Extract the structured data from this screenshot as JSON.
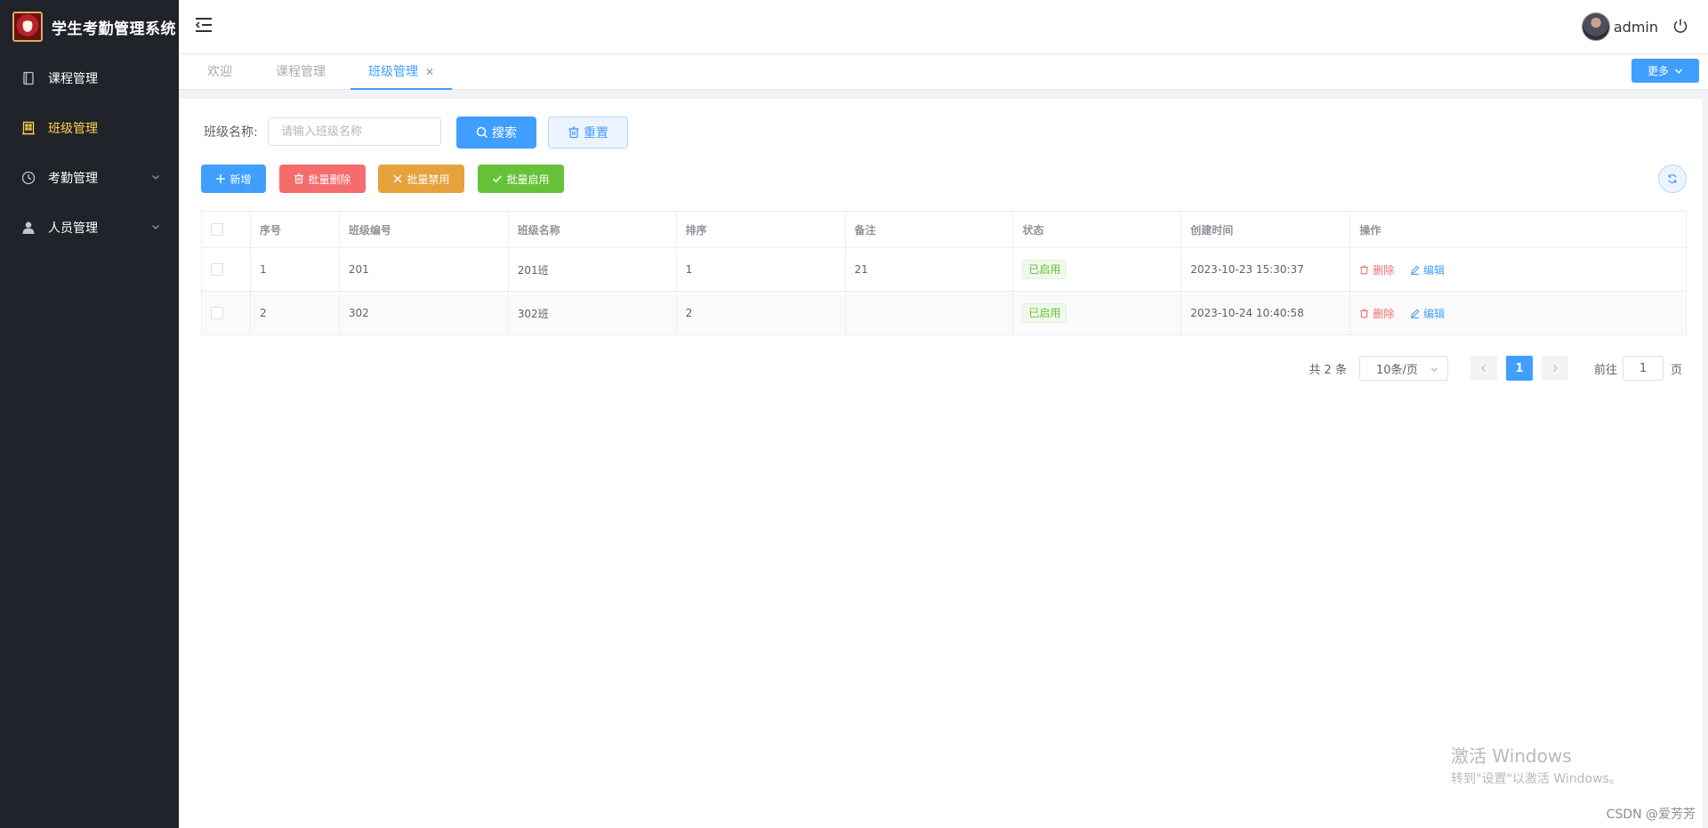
{
  "app": {
    "title": "学生考勤管理系统"
  },
  "sidebar": {
    "items": [
      {
        "label": "课程管理",
        "icon": "book-icon",
        "active": false,
        "expandable": false
      },
      {
        "label": "班级管理",
        "icon": "building-icon",
        "active": true,
        "expandable": false
      },
      {
        "label": "考勤管理",
        "icon": "clock-icon",
        "active": false,
        "expandable": true
      },
      {
        "label": "人员管理",
        "icon": "user-icon",
        "active": false,
        "expandable": true
      }
    ]
  },
  "header": {
    "username": "admin"
  },
  "tabs": [
    {
      "label": "欢迎",
      "active": false
    },
    {
      "label": "课程管理",
      "active": false
    },
    {
      "label": "班级管理",
      "active": true,
      "closable": true
    }
  ],
  "more_button": "更多",
  "search": {
    "label": "班级名称:",
    "placeholder": "请输入班级名称",
    "search_button": "搜索",
    "reset_button": "重置"
  },
  "actions": {
    "add": "新增",
    "batch_delete": "批量删除",
    "batch_disable": "批量禁用",
    "batch_enable": "批量启用"
  },
  "table": {
    "columns": [
      "序号",
      "班级编号",
      "班级名称",
      "排序",
      "备注",
      "状态",
      "创建时间",
      "操作"
    ],
    "rows": [
      {
        "index": "1",
        "code": "201",
        "name": "201班",
        "sort": "1",
        "remark": "21",
        "status": "已启用",
        "created": "2023-10-23 15:30:37",
        "delete": "删除",
        "edit": "编辑"
      },
      {
        "index": "2",
        "code": "302",
        "name": "302班",
        "sort": "2",
        "remark": "",
        "status": "已启用",
        "created": "2023-10-24 10:40:58",
        "delete": "删除",
        "edit": "编辑"
      }
    ]
  },
  "pagination": {
    "total_text": "共 2 条",
    "page_size": "10条/页",
    "current_page": "1",
    "goto_prefix": "前往",
    "goto_value": "1",
    "goto_suffix": "页"
  },
  "watermarks": {
    "windows_line1": "激活 Windows",
    "windows_line2": "转到\"设置\"以激活 Windows。",
    "csdn": "CSDN @爱芳芳"
  },
  "colors": {
    "sidebar_bg": "#20232a",
    "active_menu": "#ffd04b",
    "primary": "#409eff",
    "danger": "#f56c6c",
    "warning": "#e6a23c",
    "success": "#67c23a"
  }
}
